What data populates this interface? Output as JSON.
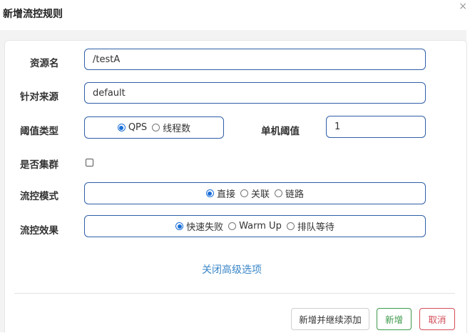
{
  "dialog": {
    "title": "新增流控规则",
    "close_glyph": "×"
  },
  "form": {
    "resource": {
      "label": "资源名",
      "value": "/testA"
    },
    "limit_app": {
      "label": "针对来源",
      "value": "default"
    },
    "grade": {
      "label": "阈值类型",
      "options": [
        "QPS",
        "线程数"
      ],
      "selected": "QPS"
    },
    "count": {
      "label": "单机阈值",
      "value": "1"
    },
    "cluster": {
      "label": "是否集群",
      "checked": false
    },
    "strategy": {
      "label": "流控模式",
      "options": [
        "直接",
        "关联",
        "链路"
      ],
      "selected": "直接"
    },
    "control_behavior": {
      "label": "流控效果",
      "options": [
        "快速失败",
        "Warm Up",
        "排队等待"
      ],
      "selected": "快速失败"
    },
    "advanced_toggle": "关闭高级选项"
  },
  "buttons": {
    "add_continue": "新增并继续添加",
    "add": "新增",
    "cancel": "取消"
  },
  "colors": {
    "field_border": "#2f5fa7",
    "link": "#3a86c8",
    "add_green": "#3c9a4a",
    "cancel_red": "#d24d57"
  }
}
